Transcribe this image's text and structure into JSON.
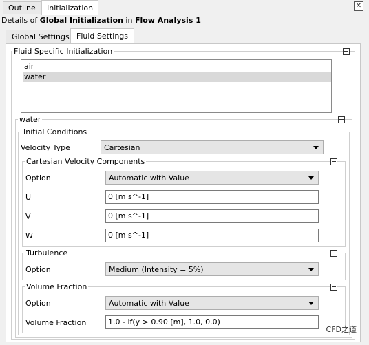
{
  "top_tabs": [
    {
      "label": "Outline"
    },
    {
      "label": "Initialization"
    }
  ],
  "close_glyph": "✕",
  "details": {
    "prefix": "Details of ",
    "object": "Global Initialization",
    "mid": " in ",
    "target": "Flow Analysis 1"
  },
  "inner_tabs": [
    {
      "label": "Global Settings"
    },
    {
      "label": "Fluid Settings"
    }
  ],
  "fluid_specific": {
    "title": "Fluid Specific Initialization",
    "fluids": [
      "air",
      "water"
    ],
    "selected_fluid": "water"
  },
  "water_group": {
    "title": "water"
  },
  "initial_conditions": {
    "title": "Initial Conditions",
    "velocity_type_label": "Velocity Type",
    "velocity_type_value": "Cartesian"
  },
  "cartesian": {
    "title": "Cartesian Velocity Components",
    "option_label": "Option",
    "option_value": "Automatic with Value",
    "u_label": "U",
    "u_value": "0 [m s^-1]",
    "v_label": "V",
    "v_value": "0 [m s^-1]",
    "w_label": "W",
    "w_value": "0 [m s^-1]"
  },
  "turbulence": {
    "title": "Turbulence",
    "option_label": "Option",
    "option_value": "Medium (Intensity = 5%)"
  },
  "volume_fraction": {
    "title": "Volume Fraction",
    "option_label": "Option",
    "option_value": "Automatic with Value",
    "vf_label": "Volume Fraction",
    "vf_value": "1.0 - if(y > 0.90 [m], 1.0, 0.0)"
  },
  "watermark": "CFD之道"
}
